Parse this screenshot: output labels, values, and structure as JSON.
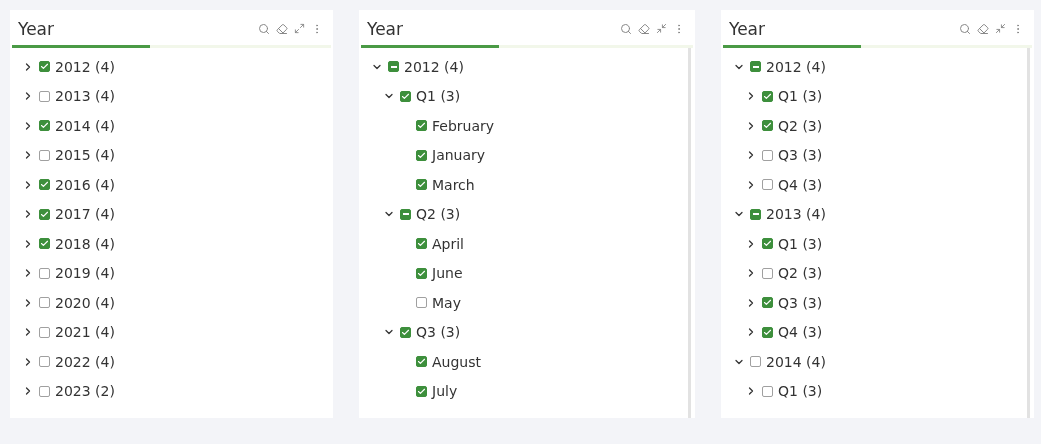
{
  "panels": [
    {
      "title": "Year",
      "collapse_all": false,
      "scrollbar": false,
      "items": [
        {
          "label": "2012 (4)",
          "checked": true,
          "indeterminate": false,
          "expanded": false
        },
        {
          "label": "2013 (4)",
          "checked": false,
          "indeterminate": false,
          "expanded": false
        },
        {
          "label": "2014 (4)",
          "checked": true,
          "indeterminate": false,
          "expanded": false
        },
        {
          "label": "2015 (4)",
          "checked": false,
          "indeterminate": false,
          "expanded": false
        },
        {
          "label": "2016 (4)",
          "checked": true,
          "indeterminate": false,
          "expanded": false
        },
        {
          "label": "2017 (4)",
          "checked": true,
          "indeterminate": false,
          "expanded": false
        },
        {
          "label": "2018 (4)",
          "checked": true,
          "indeterminate": false,
          "expanded": false
        },
        {
          "label": "2019 (4)",
          "checked": false,
          "indeterminate": false,
          "expanded": false
        },
        {
          "label": "2020 (4)",
          "checked": false,
          "indeterminate": false,
          "expanded": false
        },
        {
          "label": "2021 (4)",
          "checked": false,
          "indeterminate": false,
          "expanded": false
        },
        {
          "label": "2022 (4)",
          "checked": false,
          "indeterminate": false,
          "expanded": false
        },
        {
          "label": "2023 (2)",
          "checked": false,
          "indeterminate": false,
          "expanded": false
        }
      ]
    },
    {
      "title": "Year",
      "collapse_all": true,
      "scrollbar": true,
      "items": [
        {
          "label": "2012 (4)",
          "checked": false,
          "indeterminate": true,
          "expanded": true,
          "children": [
            {
              "label": "Q1 (3)",
              "checked": true,
              "indeterminate": false,
              "expanded": true,
              "children": [
                {
                  "label": "February",
                  "checked": true,
                  "indeterminate": false
                },
                {
                  "label": "January",
                  "checked": true,
                  "indeterminate": false
                },
                {
                  "label": "March",
                  "checked": true,
                  "indeterminate": false
                }
              ]
            },
            {
              "label": "Q2 (3)",
              "checked": false,
              "indeterminate": true,
              "expanded": true,
              "children": [
                {
                  "label": "April",
                  "checked": true,
                  "indeterminate": false
                },
                {
                  "label": "June",
                  "checked": true,
                  "indeterminate": false
                },
                {
                  "label": "May",
                  "checked": false,
                  "indeterminate": false
                }
              ]
            },
            {
              "label": "Q3 (3)",
              "checked": true,
              "indeterminate": false,
              "expanded": true,
              "children": [
                {
                  "label": "August",
                  "checked": true,
                  "indeterminate": false
                },
                {
                  "label": "July",
                  "checked": true,
                  "indeterminate": false
                }
              ]
            }
          ]
        }
      ]
    },
    {
      "title": "Year",
      "collapse_all": true,
      "scrollbar": true,
      "items": [
        {
          "label": "2012 (4)",
          "checked": false,
          "indeterminate": true,
          "expanded": true,
          "children": [
            {
              "label": "Q1 (3)",
              "checked": true,
              "indeterminate": false,
              "expanded": false
            },
            {
              "label": "Q2 (3)",
              "checked": true,
              "indeterminate": false,
              "expanded": false
            },
            {
              "label": "Q3 (3)",
              "checked": false,
              "indeterminate": false,
              "expanded": false
            },
            {
              "label": "Q4 (3)",
              "checked": false,
              "indeterminate": false,
              "expanded": false
            }
          ]
        },
        {
          "label": "2013 (4)",
          "checked": false,
          "indeterminate": true,
          "expanded": true,
          "children": [
            {
              "label": "Q1 (3)",
              "checked": true,
              "indeterminate": false,
              "expanded": false
            },
            {
              "label": "Q2 (3)",
              "checked": false,
              "indeterminate": false,
              "expanded": false
            },
            {
              "label": "Q3 (3)",
              "checked": true,
              "indeterminate": false,
              "expanded": false
            },
            {
              "label": "Q4 (3)",
              "checked": true,
              "indeterminate": false,
              "expanded": false
            }
          ]
        },
        {
          "label": "2014 (4)",
          "checked": false,
          "indeterminate": false,
          "expanded": true,
          "children": [
            {
              "label": "Q1 (3)",
              "checked": false,
              "indeterminate": false,
              "expanded": false
            }
          ]
        }
      ]
    }
  ]
}
